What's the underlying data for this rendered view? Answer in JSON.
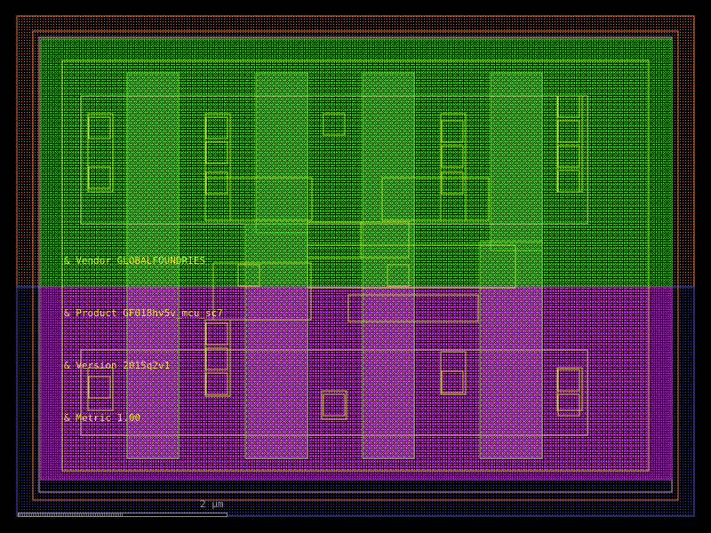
{
  "colors": {
    "background": "#000000",
    "nwell": "#e8743a",
    "pwell": "#3a3ab8",
    "diffusion_upper": "#40d040",
    "diffusion_lower": "#c040d0",
    "poly": "#7ad83a",
    "metal1": "#b8e030",
    "contact": "#c8d028",
    "text": "#e8e83a"
  },
  "annotations": [
    "& Vendor GLOBALFOUNDRIES",
    "& Product GF018hv5v_mcu_sc7",
    "& Version 2015q2v1",
    "& Metric 1.00"
  ],
  "scalebar": {
    "label": "2 µm"
  }
}
